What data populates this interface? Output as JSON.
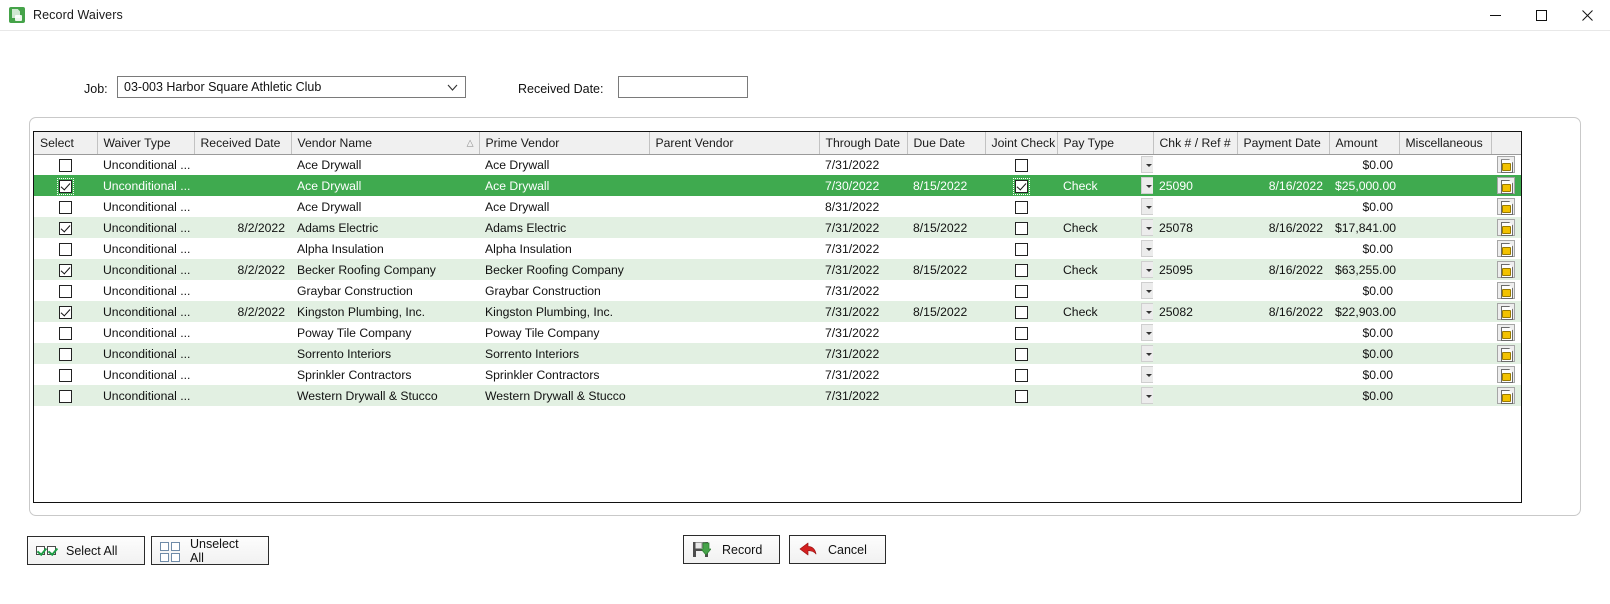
{
  "window": {
    "title": "Record Waivers",
    "app_icon": "waiver-app-icon",
    "minimize": "minimize-icon",
    "maximize": "maximize-icon",
    "close": "close-icon"
  },
  "form": {
    "job_label": "Job:",
    "job_value": "03-003  Harbor Square Athletic Club",
    "job_chevron": "chevron-down-icon",
    "received_date_label": "Received Date:",
    "received_date_value": "",
    "received_date_placeholder": ""
  },
  "grid": {
    "columns": [
      "Select",
      "Waiver Type",
      "Received Date",
      "Vendor Name",
      "Prime Vendor",
      "Parent Vendor",
      "Through Date",
      "Due Date",
      "Joint Check",
      "Pay Type",
      "Chk # / Ref #",
      "Payment Date",
      "Amount",
      "Miscellaneous",
      ""
    ],
    "sorted_column": "Vendor Name",
    "sort_marker": "△",
    "misc_icon": "document-note-icon",
    "rows": [
      {
        "select": false,
        "selected": false,
        "waiver_type": "Unconditional ...",
        "received_date": "",
        "vendor_name": "Ace Drywall",
        "prime_vendor": "Ace Drywall",
        "parent_vendor": "",
        "through_date": "7/31/2022",
        "due_date": "",
        "joint_check": false,
        "pay_type": "",
        "chk_ref": "",
        "payment_date": "",
        "amount": "$0.00"
      },
      {
        "select": true,
        "selected": true,
        "waiver_type": "Unconditional ...",
        "received_date": "",
        "vendor_name": "Ace Drywall",
        "prime_vendor": "Ace Drywall",
        "parent_vendor": "",
        "through_date": "7/30/2022",
        "due_date": "8/15/2022",
        "joint_check": true,
        "pay_type": "Check",
        "chk_ref": "25090",
        "payment_date": "8/16/2022",
        "amount": "$25,000.00"
      },
      {
        "select": false,
        "selected": false,
        "waiver_type": "Unconditional ...",
        "received_date": "",
        "vendor_name": "Ace Drywall",
        "prime_vendor": "Ace Drywall",
        "parent_vendor": "",
        "through_date": "8/31/2022",
        "due_date": "",
        "joint_check": false,
        "pay_type": "",
        "chk_ref": "",
        "payment_date": "",
        "amount": "$0.00"
      },
      {
        "select": true,
        "selected": false,
        "waiver_type": "Unconditional ...",
        "received_date": "8/2/2022",
        "vendor_name": "Adams Electric",
        "prime_vendor": "Adams Electric",
        "parent_vendor": "",
        "through_date": "7/31/2022",
        "due_date": "8/15/2022",
        "joint_check": false,
        "pay_type": "Check",
        "chk_ref": "25078",
        "payment_date": "8/16/2022",
        "amount": "$17,841.00"
      },
      {
        "select": false,
        "selected": false,
        "waiver_type": "Unconditional ...",
        "received_date": "",
        "vendor_name": "Alpha Insulation",
        "prime_vendor": "Alpha Insulation",
        "parent_vendor": "",
        "through_date": "7/31/2022",
        "due_date": "",
        "joint_check": false,
        "pay_type": "",
        "chk_ref": "",
        "payment_date": "",
        "amount": "$0.00"
      },
      {
        "select": true,
        "selected": false,
        "waiver_type": "Unconditional ...",
        "received_date": "8/2/2022",
        "vendor_name": "Becker Roofing Company",
        "prime_vendor": "Becker Roofing Company",
        "parent_vendor": "",
        "through_date": "7/31/2022",
        "due_date": "8/15/2022",
        "joint_check": false,
        "pay_type": "Check",
        "chk_ref": "25095",
        "payment_date": "8/16/2022",
        "amount": "$63,255.00"
      },
      {
        "select": false,
        "selected": false,
        "waiver_type": "Unconditional ...",
        "received_date": "",
        "vendor_name": "Graybar Construction",
        "prime_vendor": "Graybar Construction",
        "parent_vendor": "",
        "through_date": "7/31/2022",
        "due_date": "",
        "joint_check": false,
        "pay_type": "",
        "chk_ref": "",
        "payment_date": "",
        "amount": "$0.00"
      },
      {
        "select": true,
        "selected": false,
        "waiver_type": "Unconditional ...",
        "received_date": "8/2/2022",
        "vendor_name": "Kingston Plumbing, Inc.",
        "prime_vendor": "Kingston Plumbing, Inc.",
        "parent_vendor": "",
        "through_date": "7/31/2022",
        "due_date": "8/15/2022",
        "joint_check": false,
        "pay_type": "Check",
        "chk_ref": "25082",
        "payment_date": "8/16/2022",
        "amount": "$22,903.00"
      },
      {
        "select": false,
        "selected": false,
        "waiver_type": "Unconditional ...",
        "received_date": "",
        "vendor_name": "Poway Tile Company",
        "prime_vendor": "Poway Tile Company",
        "parent_vendor": "",
        "through_date": "7/31/2022",
        "due_date": "",
        "joint_check": false,
        "pay_type": "",
        "chk_ref": "",
        "payment_date": "",
        "amount": "$0.00"
      },
      {
        "select": false,
        "selected": false,
        "waiver_type": "Unconditional ...",
        "received_date": "",
        "vendor_name": "Sorrento Interiors",
        "prime_vendor": "Sorrento Interiors",
        "parent_vendor": "",
        "through_date": "7/31/2022",
        "due_date": "",
        "joint_check": false,
        "pay_type": "",
        "chk_ref": "",
        "payment_date": "",
        "amount": "$0.00"
      },
      {
        "select": false,
        "selected": false,
        "waiver_type": "Unconditional ...",
        "received_date": "",
        "vendor_name": "Sprinkler Contractors",
        "prime_vendor": "Sprinkler Contractors",
        "parent_vendor": "",
        "through_date": "7/31/2022",
        "due_date": "",
        "joint_check": false,
        "pay_type": "",
        "chk_ref": "",
        "payment_date": "",
        "amount": "$0.00"
      },
      {
        "select": false,
        "selected": false,
        "waiver_type": "Unconditional ...",
        "received_date": "",
        "vendor_name": "Western Drywall & Stucco",
        "prime_vendor": "Western Drywall & Stucco",
        "parent_vendor": "",
        "through_date": "7/31/2022",
        "due_date": "",
        "joint_check": false,
        "pay_type": "",
        "chk_ref": "",
        "payment_date": "",
        "amount": "$0.00"
      }
    ]
  },
  "footer": {
    "select_all": "Select All",
    "unselect_all": "Unselect All",
    "record": "Record",
    "cancel": "Cancel",
    "select_all_icon": "checked-boxes-icon",
    "unselect_all_icon": "empty-boxes-icon",
    "record_icon": "save-disk-icon",
    "cancel_icon": "red-back-arrow-icon"
  },
  "colors": {
    "selected_row": "#3faa4f",
    "alt_row": "#e2f0e2",
    "accent_green": "#45a349",
    "cancel_red": "#d32020"
  }
}
